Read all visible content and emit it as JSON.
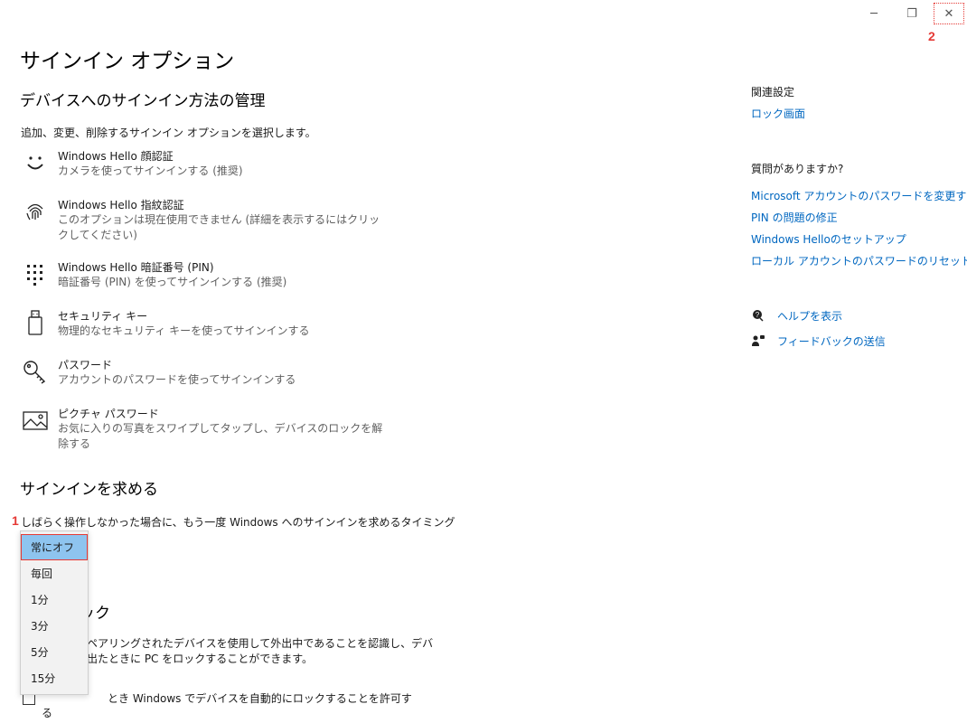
{
  "window": {
    "minimize_glyph": "─",
    "restore_glyph": "❐",
    "close_glyph": "✕"
  },
  "annotations": {
    "first": "1",
    "second": "2"
  },
  "page_title": "サインイン オプション",
  "manage_heading": "デバイスへのサインイン方法の管理",
  "manage_desc": "追加、変更、削除するサインイン オプションを選択します。",
  "options": [
    {
      "icon": "face-icon",
      "title": "Windows Hello 顔認証",
      "desc": "カメラを使ってサインインする (推奨)"
    },
    {
      "icon": "fingerprint-icon",
      "title": "Windows Hello 指紋認証",
      "desc": "このオプションは現在使用できません (詳細を表示するにはクリックしてください)"
    },
    {
      "icon": "pin-keypad-icon",
      "title": "Windows Hello 暗証番号 (PIN)",
      "desc": "暗証番号 (PIN) を使ってサインインする (推奨)"
    },
    {
      "icon": "usb-key-icon",
      "title": "セキュリティ キー",
      "desc": "物理的なセキュリティ キーを使ってサインインする"
    },
    {
      "icon": "key-icon",
      "title": "パスワード",
      "desc": "アカウントのパスワードを使ってサインインする"
    },
    {
      "icon": "picture-icon",
      "title": "ピクチャ パスワード",
      "desc": "お気に入りの写真をスワイプしてタップし、デバイスのロックを解除する"
    }
  ],
  "require_signin": {
    "heading": "サインインを求める",
    "desc": "しばらく操作しなかった場合に、もう一度 Windows へのサインインを求めるタイミング"
  },
  "dropdown": {
    "selected": "常にオフ",
    "options": [
      "常にオフ",
      "毎回",
      "1分",
      "3分",
      "5分",
      "15分"
    ]
  },
  "dynamic_lock": {
    "heading_partial": "ック",
    "desc_line1": "ペアリングされたデバイスを使用して外出中であることを認識し、デバ",
    "desc_line2": "出たときに PC をロックすることができます。",
    "checkbox_line1": "とき Windows でデバイスを自動的にロックすることを許可す",
    "checkbox_line2": "る"
  },
  "related": {
    "heading": "関連設定",
    "link": "ロック画面"
  },
  "questions": {
    "heading": "質問がありますか?",
    "links": [
      "Microsoft アカウントのパスワードを変更する",
      "PIN の問題の修正",
      "Windows Helloのセットアップ",
      "ローカル アカウントのパスワードのリセット"
    ]
  },
  "help": {
    "help_link": "ヘルプを表示",
    "feedback_link": "フィードバックの送信"
  },
  "colors": {
    "link": "#0067c0",
    "annotation": "#e53935",
    "selected": "#8ec4ef"
  }
}
